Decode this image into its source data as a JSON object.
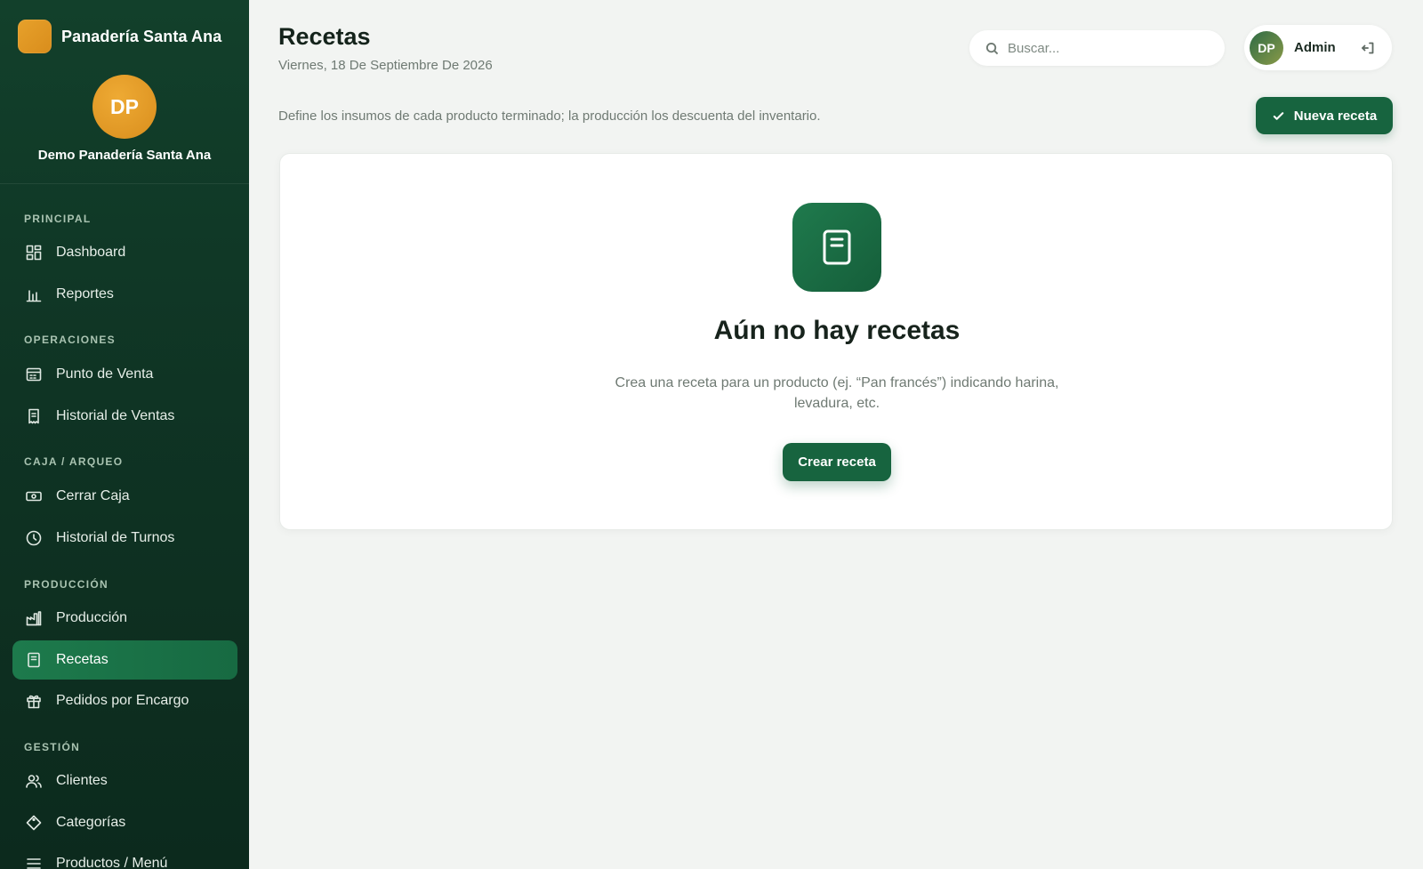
{
  "brand": {
    "name": "Panadería Santa Ana"
  },
  "profile": {
    "initials": "DP",
    "name": "Demo Panadería Santa Ana"
  },
  "sidebar": {
    "sections": [
      {
        "title": "PRINCIPAL"
      },
      {
        "title": "OPERACIONES"
      },
      {
        "title": "CAJA / ARQUEO"
      },
      {
        "title": "PRODUCCIÓN"
      },
      {
        "title": "GESTIÓN"
      }
    ],
    "items": [
      {
        "label": "Dashboard",
        "icon": "grid-icon"
      },
      {
        "label": "Reportes",
        "icon": "bar-chart-icon"
      },
      {
        "label": "Punto de Venta",
        "icon": "register-icon"
      },
      {
        "label": "Historial de Ventas",
        "icon": "receipt-icon"
      },
      {
        "label": "Cerrar Caja",
        "icon": "banknote-icon"
      },
      {
        "label": "Historial de Turnos",
        "icon": "clock-icon"
      },
      {
        "label": "Producción",
        "icon": "factory-icon"
      },
      {
        "label": "Recetas",
        "icon": "book-icon",
        "active": true
      },
      {
        "label": "Pedidos por Encargo",
        "icon": "gift-icon"
      },
      {
        "label": "Clientes",
        "icon": "users-icon"
      },
      {
        "label": "Categorías",
        "icon": "tag-icon"
      },
      {
        "label": "Productos / Menú",
        "icon": "menu-icon"
      }
    ]
  },
  "header": {
    "title": "Recetas",
    "date": "Viernes, 18 De Septiembre De 2026",
    "search_placeholder": "Buscar...",
    "user_initials": "DP",
    "user_name": "Admin"
  },
  "main": {
    "description": "Define los insumos de cada producto terminado; la producción los descuenta del inventario.",
    "new_button": "Nueva receta",
    "empty": {
      "title": "Aún no hay recetas",
      "text": "Crea una receta para un producto (ej. “Pan francés”) indicando harina, levadura, etc.",
      "button": "Crear receta"
    }
  },
  "colors": {
    "sidebar": "#0f3424",
    "accent": "#17643f",
    "brand_orange": "#e7a12b"
  }
}
